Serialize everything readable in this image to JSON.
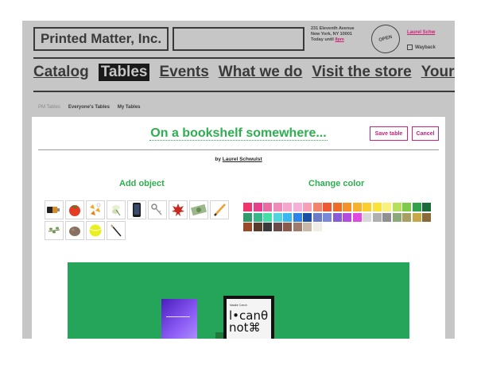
{
  "header": {
    "logo": "Printed Matter, Inc.",
    "address_line1": "231 Eleventh Avenue",
    "address_line2": "New York, NY 10001",
    "hours_prefix": "Today until ",
    "hours_link": "8pm",
    "open_badge": "OPEN",
    "user_link": "Laurel Schw",
    "wayback": "Wayback"
  },
  "nav": [
    "Catalog",
    "Tables",
    "Events",
    "What we do",
    "Visit the store",
    "Your cart"
  ],
  "subtabs": [
    "PM Tables",
    "Everyone's Tables",
    "My Tables"
  ],
  "editor": {
    "title": "On a bookshelf somewhere...",
    "save": "Save table",
    "cancel": "Cancel",
    "by": "by",
    "author": "Laurel Schwulst",
    "add_object": "Add object",
    "change_color": "Change color"
  },
  "objects": [
    "battery-icon",
    "tomato-icon",
    "candy-corn-icon",
    "flower-icon",
    "smartphone-icon",
    "keys-icon",
    "maple-leaf-icon",
    "dollar-bill-icon",
    "pencil-icon",
    "herb-sprig-icon",
    "stone-icon",
    "tennis-ball-icon",
    "paintbrush-icon"
  ],
  "colors": [
    "#f0356e",
    "#e83d8a",
    "#ea6aa3",
    "#f08ab8",
    "#f4a6cc",
    "#f6b0d8",
    "#f7a0b5",
    "#f3846c",
    "#ef5a35",
    "#f06a28",
    "#f5902a",
    "#f7b22d",
    "#f9cf30",
    "#fbe23a",
    "#fbf07a",
    "#b6e05a",
    "#7ccc4a",
    "#2fa34a",
    "#1b6b3a",
    "#2f9a6a",
    "#35b888",
    "#43e0a6",
    "#4fd4e0",
    "#39b7f0",
    "#2e84e8",
    "#1a4fa8",
    "#6a7cc8",
    "#7a88d8",
    "#8a5ad8",
    "#b44ae0",
    "#e04ae0",
    "#d8d8d8",
    "#b0b0b0",
    "#909090",
    "#8aa878",
    "#a8a060",
    "#c8a848",
    "#8a6a38",
    "#9a4a2a",
    "#5a3a2a",
    "#3a3a3a",
    "#6a4a4a",
    "#8a5a4a",
    "#a07a6a",
    "#c8b8a8",
    "#f0ece6"
  ],
  "canvas": {
    "color": "#25a55a",
    "book2_small": "Natalie Czech",
    "book2_big_1": "l•canθ",
    "book2_big_2": "not⌘"
  }
}
